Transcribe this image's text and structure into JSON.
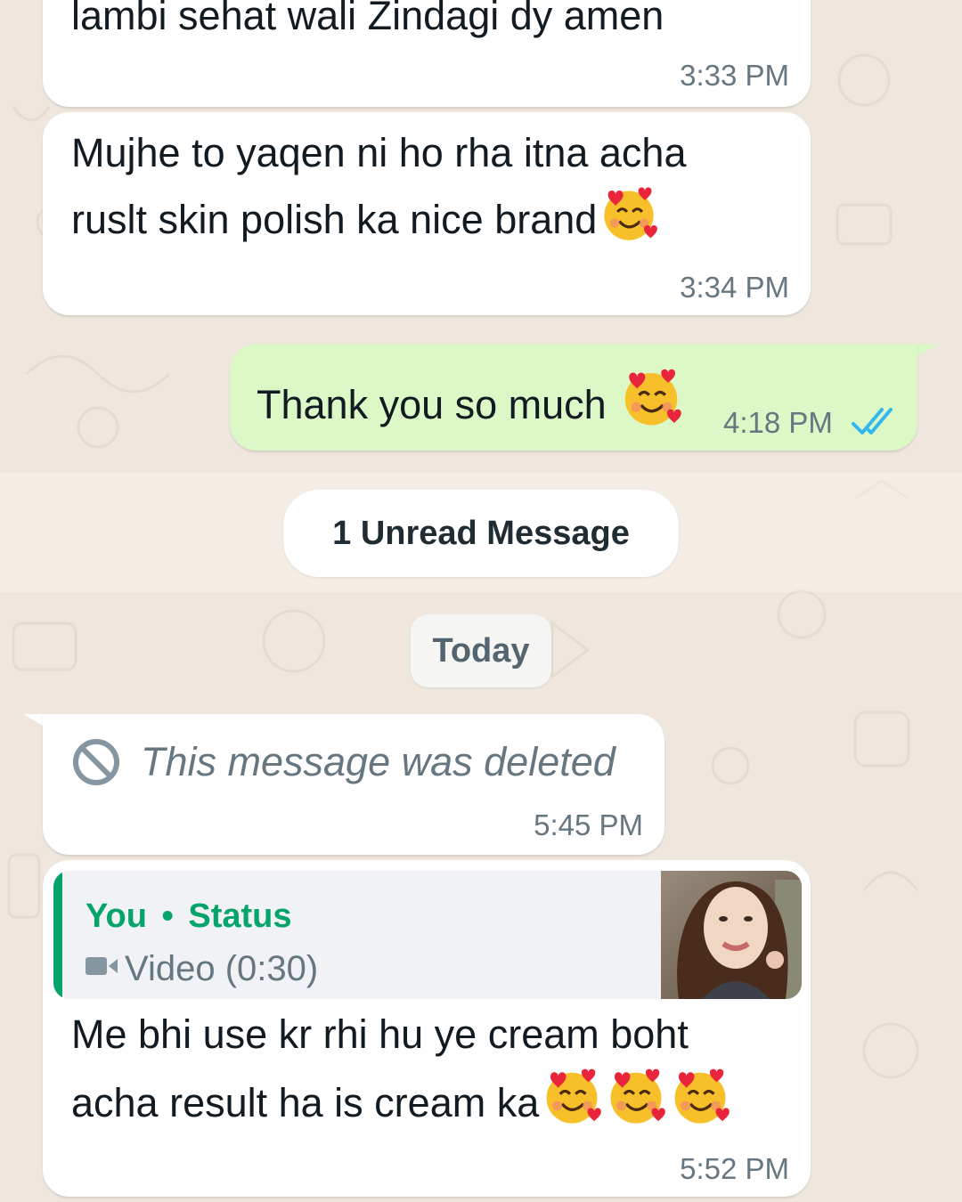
{
  "messages": [
    {
      "text": "lambi sehat wali Zindagi dy amen",
      "time": "3:33 PM"
    },
    {
      "line1": "Mujhe to yaqen ni ho rha itna acha",
      "line2": "ruslt skin polish ka nice brand",
      "emoji": "smiling-face-with-hearts",
      "time": "3:34 PM"
    },
    {
      "text": "Thank you so much",
      "emoji": "smiling-face-with-hearts",
      "time": "4:18 PM",
      "status": "read-double-check"
    },
    {
      "text": "This message was deleted",
      "icon": "prohibited-icon",
      "time": "5:45 PM"
    },
    {
      "reply": {
        "author": "You",
        "separator": "•",
        "source": "Status",
        "media_icon": "video-camera-icon",
        "media_label": "Video (0:30)"
      },
      "line1": "Me bhi use kr rhi hu ye cream boht",
      "line2": "acha result ha is cream ka",
      "emoji": "smiling-face-with-hearts",
      "emoji_count": 3,
      "time": "5:52 PM"
    }
  ],
  "unread": {
    "label": "1 Unread Message"
  },
  "date_divider": {
    "label": "Today"
  },
  "colors": {
    "chat_background": "#efe7de",
    "incoming_bubble": "#ffffff",
    "outgoing_bubble": "#dcf8c6",
    "timestamp": "#667781",
    "read_ticks": "#34b7f1",
    "reply_accent": "#06a36b"
  }
}
